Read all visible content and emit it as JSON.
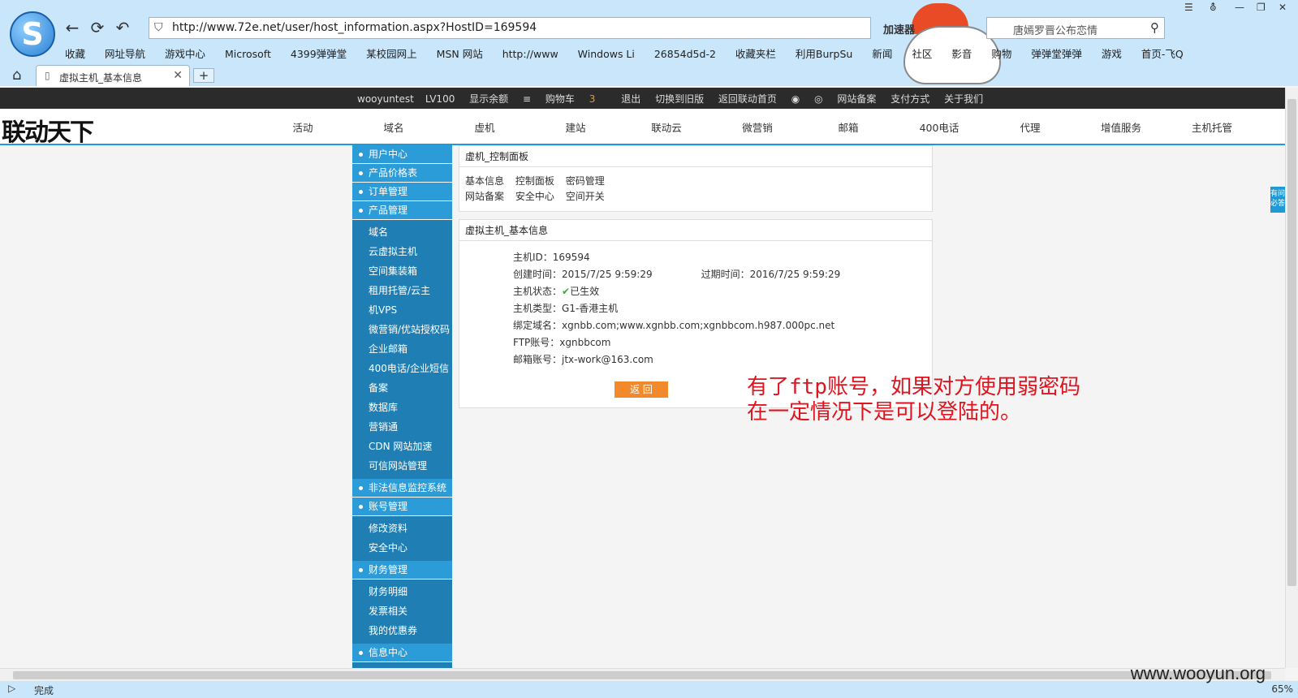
{
  "browser": {
    "url": "http://www.72e.net/user/host_information.aspx?HostID=169594",
    "accelerator_label": "加速器",
    "search_text": "唐嫣罗晋公布恋情",
    "tab_title": "虚拟主机_基本信息",
    "status_text": "完成",
    "zoom": "65%",
    "bookmarks": [
      "收藏",
      "网址导航",
      "游戏中心",
      "Microsoft",
      "4399弹弹堂",
      "某校园网上",
      "MSN 网站",
      "http://www",
      "Windows Li",
      "26854d5d-2",
      "收藏夹栏",
      "利用BurpSu",
      "新闻",
      "社区",
      "影音",
      "购物",
      "弹弹堂弹弹",
      "游戏",
      "首页-飞Q"
    ]
  },
  "topbar": {
    "user": "wooyuntest",
    "level": "LV100",
    "balance": "显示余额",
    "cart": "购物车",
    "cart_count": "3",
    "logout": "退出",
    "old_version": "切换到旧版",
    "back_home": "返回联动首页",
    "filing": "网站备案",
    "payment": "支付方式",
    "about": "关于我们"
  },
  "header": {
    "brand": "联动天下",
    "nav": [
      "活动",
      "域名",
      "虚机",
      "建站",
      "联动云",
      "微营销",
      "邮箱",
      "400电话",
      "代理",
      "增值服务",
      "主机托管"
    ]
  },
  "sidebar": {
    "user_center": "用户中心",
    "price_list": "产品价格表",
    "order_mgmt": "订单管理",
    "product_mgmt": "产品管理",
    "product_items": [
      "域名",
      "云虚拟主机",
      "空间集装箱",
      "租用托管/云主",
      "机VPS",
      "微营销/优站授权码",
      "企业邮箱",
      "400电话/企业短信",
      "备案",
      "数据库",
      "营销通",
      "CDN 网站加速",
      "可信网站管理"
    ],
    "illegal_monitor": "非法信息监控系统",
    "account_mgmt": "账号管理",
    "account_items": [
      "修改资料",
      "安全中心"
    ],
    "finance_mgmt": "财务管理",
    "finance_items": [
      "财务明细",
      "发票相关",
      "我的优惠券"
    ],
    "info_center": "信息中心"
  },
  "panel_control": {
    "title": "虚机_控制面板",
    "links_row1": [
      "基本信息",
      "控制面板",
      "密码管理"
    ],
    "links_row2": [
      "网站备案",
      "安全中心",
      "空间开关"
    ]
  },
  "panel_info": {
    "title": "虚拟主机_基本信息",
    "host_id_label": "主机ID：",
    "host_id": "169594",
    "created_label": "创建时间：",
    "created": "2015/7/25 9:59:29",
    "expires_label": "过期时间：",
    "expires": "2016/7/25 9:59:29",
    "status_label": "主机状态：",
    "status": "已生效",
    "type_label": "主机类型：",
    "type": "G1-香港主机",
    "domains_label": "绑定域名：",
    "domains": "xgnbb.com;www.xgnbb.com;xgnbbcom.h987.000pc.net",
    "ftp_label": "FTP账号：",
    "ftp": "xgnbbcom",
    "email_label": "邮箱账号：",
    "email": "jtx-work@163.com",
    "back_button": "返 回"
  },
  "annotation": {
    "line1": "有了ftp账号，如果对方使用弱密码",
    "line2": "在一定情况下是可以登陆的。"
  },
  "side_tag": "有问必答",
  "watermark": "www.wooyun.org"
}
